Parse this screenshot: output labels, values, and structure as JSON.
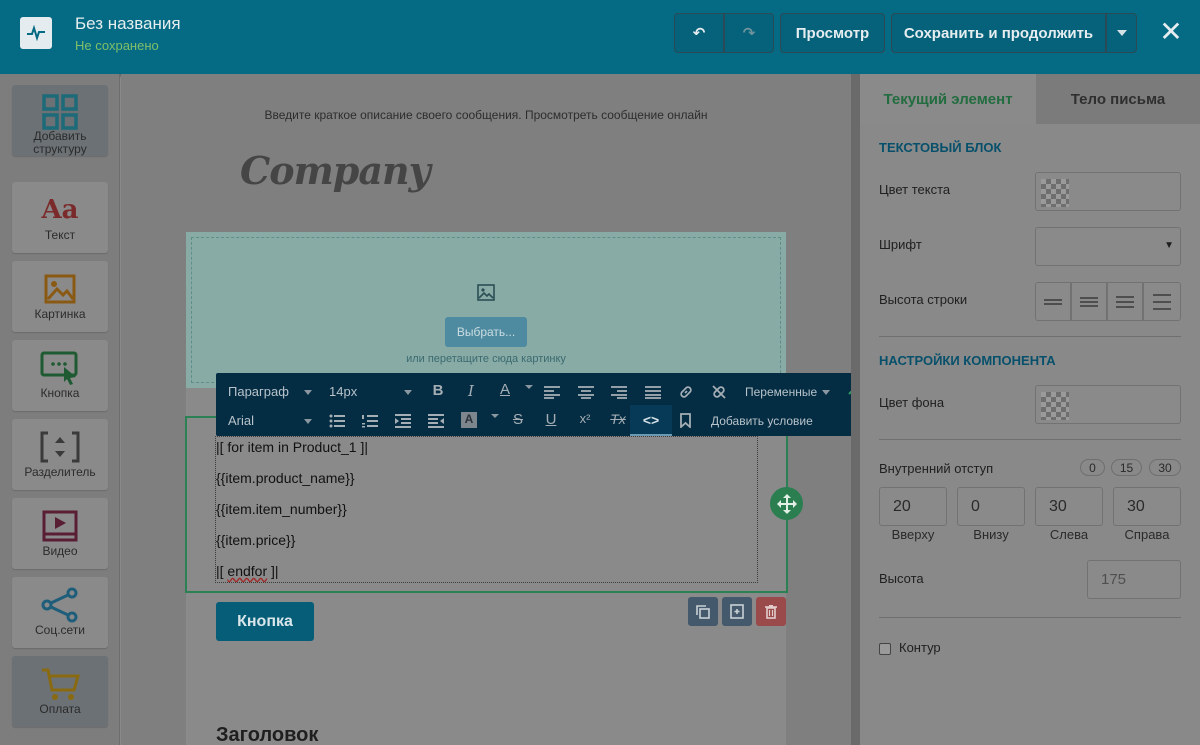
{
  "topbar": {
    "title": "Без названия",
    "status": "Не сохранено",
    "undo_icon": "↶",
    "redo_icon": "↷",
    "preview_label": "Просмотр",
    "save_label": "Сохранить и продолжить",
    "close_icon": "✕"
  },
  "sidebar": {
    "items": [
      {
        "label": "Добавить структуру",
        "icon": "grid-icon"
      },
      {
        "label": "Текст",
        "icon": "Aa"
      },
      {
        "label": "Картинка",
        "icon": "image-icon"
      },
      {
        "label": "Кнопка",
        "icon": "button-icon"
      },
      {
        "label": "Разделитель",
        "icon": "divider-icon"
      },
      {
        "label": "Видео",
        "icon": "video-icon"
      },
      {
        "label": "Соц.сети",
        "icon": "share-icon"
      },
      {
        "label": "Оплата",
        "icon": "cart-icon"
      }
    ]
  },
  "canvas": {
    "preheader": "Введите краткое описание своего сообщения. Просмотреть сообщение онлайн",
    "logo_text": "Company",
    "image_block": {
      "choose_label": "Выбрать...",
      "drop_hint": "или перетащите сюда картинку"
    },
    "text_lines": [
      "|[ for item in Product_1 ]|",
      "{{item.product_name}}",
      "{{item.item_number}}",
      "{{item.price}}"
    ],
    "endfor_prefix": "|[ ",
    "endfor_word": "endfor",
    "endfor_suffix": " ]|",
    "button_label": "Кнопка",
    "heading": "Заголовок"
  },
  "editor_toolbar": {
    "paragraph": "Параграф",
    "font_size": "14px",
    "font_family": "Arial",
    "variables": "Переменные",
    "add_condition": "Добавить условие",
    "bold": "B",
    "italic": "I",
    "text_color": "A",
    "underline": "U",
    "strike": "S",
    "superscript": "x²",
    "clear_format": "Tx",
    "code": "<>"
  },
  "panel": {
    "tabs": [
      "Текущий элемент",
      "Тело письма"
    ],
    "text_block_title": "Текстовый блок",
    "text_color_label": "Цвет текста",
    "font_label": "Шрифт",
    "line_height_label": "Высота строки",
    "component_settings_title": "Настройки компонента",
    "bg_color_label": "Цвет фона",
    "padding_label": "Внутренний отступ",
    "padding_presets": [
      "0",
      "15",
      "30"
    ],
    "padding_values": [
      {
        "label": "Вверху",
        "value": "20"
      },
      {
        "label": "Внизу",
        "value": "0"
      },
      {
        "label": "Слева",
        "value": "30"
      },
      {
        "label": "Справа",
        "value": "30"
      }
    ],
    "height_label": "Высота",
    "height_placeholder": "175",
    "outline_label": "Контур"
  },
  "colors": {
    "topbar": "#056a83",
    "accent_green": "#2b8054",
    "toolbar_bg": "#042c43",
    "section_title": "#07506b"
  }
}
